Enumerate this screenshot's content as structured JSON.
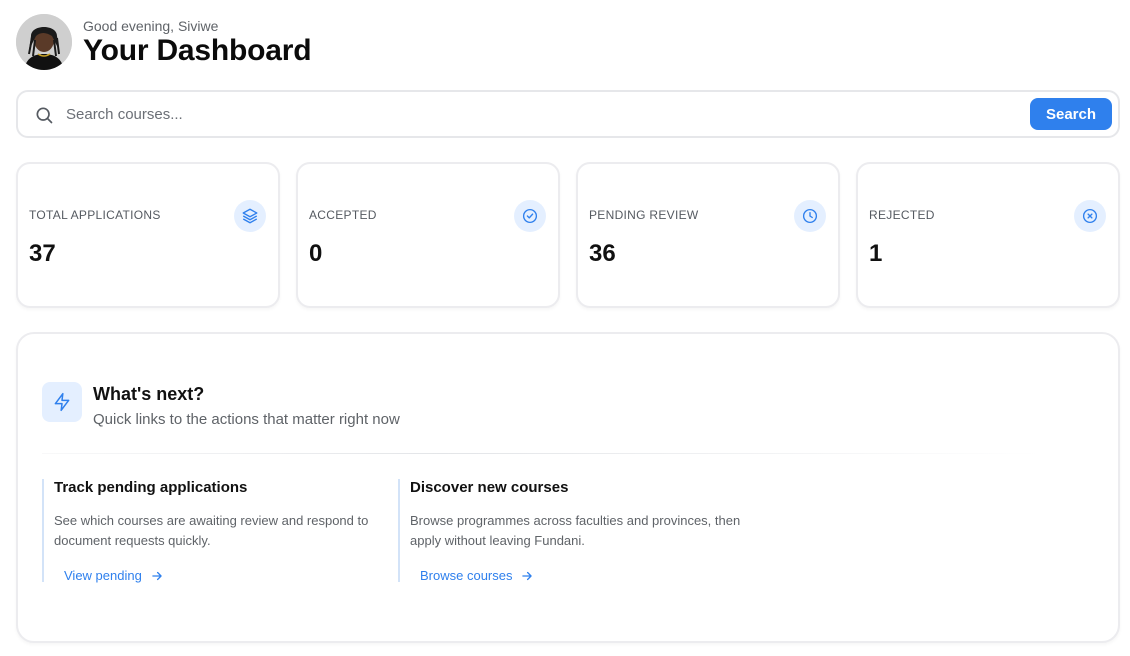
{
  "header": {
    "greeting": "Good evening, Siviwe",
    "title": "Your Dashboard"
  },
  "search": {
    "placeholder": "Search courses...",
    "value": "",
    "button_label": "Search"
  },
  "stats": [
    {
      "label": "TOTAL APPLICATIONS",
      "value": "37",
      "icon": "layers-icon"
    },
    {
      "label": "ACCEPTED",
      "value": "0",
      "icon": "check-circle-icon"
    },
    {
      "label": "PENDING REVIEW",
      "value": "36",
      "icon": "clock-icon"
    },
    {
      "label": "REJECTED",
      "value": "1",
      "icon": "x-circle-icon"
    }
  ],
  "whats_next": {
    "title": "What's next?",
    "subtitle": "Quick links to the actions that matter right now",
    "icon": "lightning-icon",
    "links": [
      {
        "title": "Track pending applications",
        "description": "See which courses are awaiting review and respond to document requests quickly.",
        "link_label": "View pending"
      },
      {
        "title": "Discover new courses",
        "description": "Browse programmes across faculties and provinces, then apply without leaving Fundani.",
        "link_label": "Browse courses"
      }
    ]
  },
  "colors": {
    "accent": "#2f80ed",
    "icon_bg": "#e4efff",
    "border": "#ececef"
  }
}
